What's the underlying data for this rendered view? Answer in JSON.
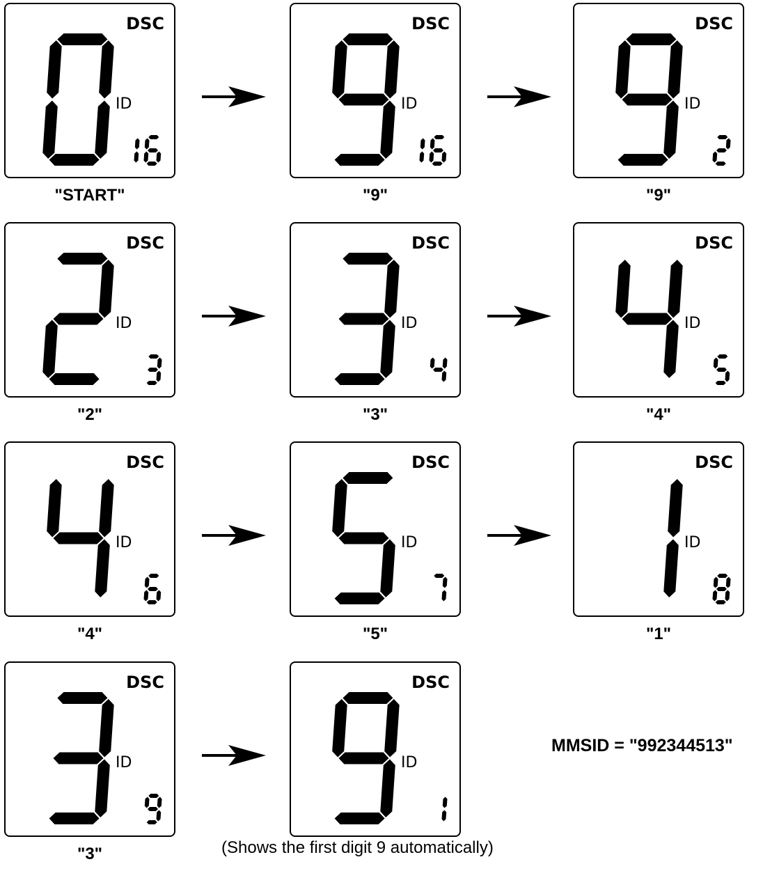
{
  "panel_label_top": "DSC",
  "panel_label_mid": "ID",
  "steps": [
    {
      "big_digit": "0",
      "small_digits": "16",
      "caption": "\"START\""
    },
    {
      "big_digit": "9",
      "small_digits": "16",
      "caption": "\"9\""
    },
    {
      "big_digit": "9",
      "small_digits": "2",
      "caption": "\"9\""
    },
    {
      "big_digit": "2",
      "small_digits": "3",
      "caption": "\"2\""
    },
    {
      "big_digit": "3",
      "small_digits": "4",
      "caption": "\"3\""
    },
    {
      "big_digit": "4",
      "small_digits": "5",
      "caption": "\"4\""
    },
    {
      "big_digit": "4",
      "small_digits": "6",
      "caption": "\"4\""
    },
    {
      "big_digit": "5",
      "small_digits": "7",
      "caption": "\"5\""
    },
    {
      "big_digit": "1",
      "small_digits": "8",
      "caption": "\"1\""
    },
    {
      "big_digit": "3",
      "small_digits": "9",
      "caption": "\"3\""
    },
    {
      "big_digit": "9",
      "small_digits": "1",
      "caption": ""
    }
  ],
  "mmsid_result": "MMSID = \"992344513\"",
  "footnote": "(Shows the first digit 9 automatically)"
}
